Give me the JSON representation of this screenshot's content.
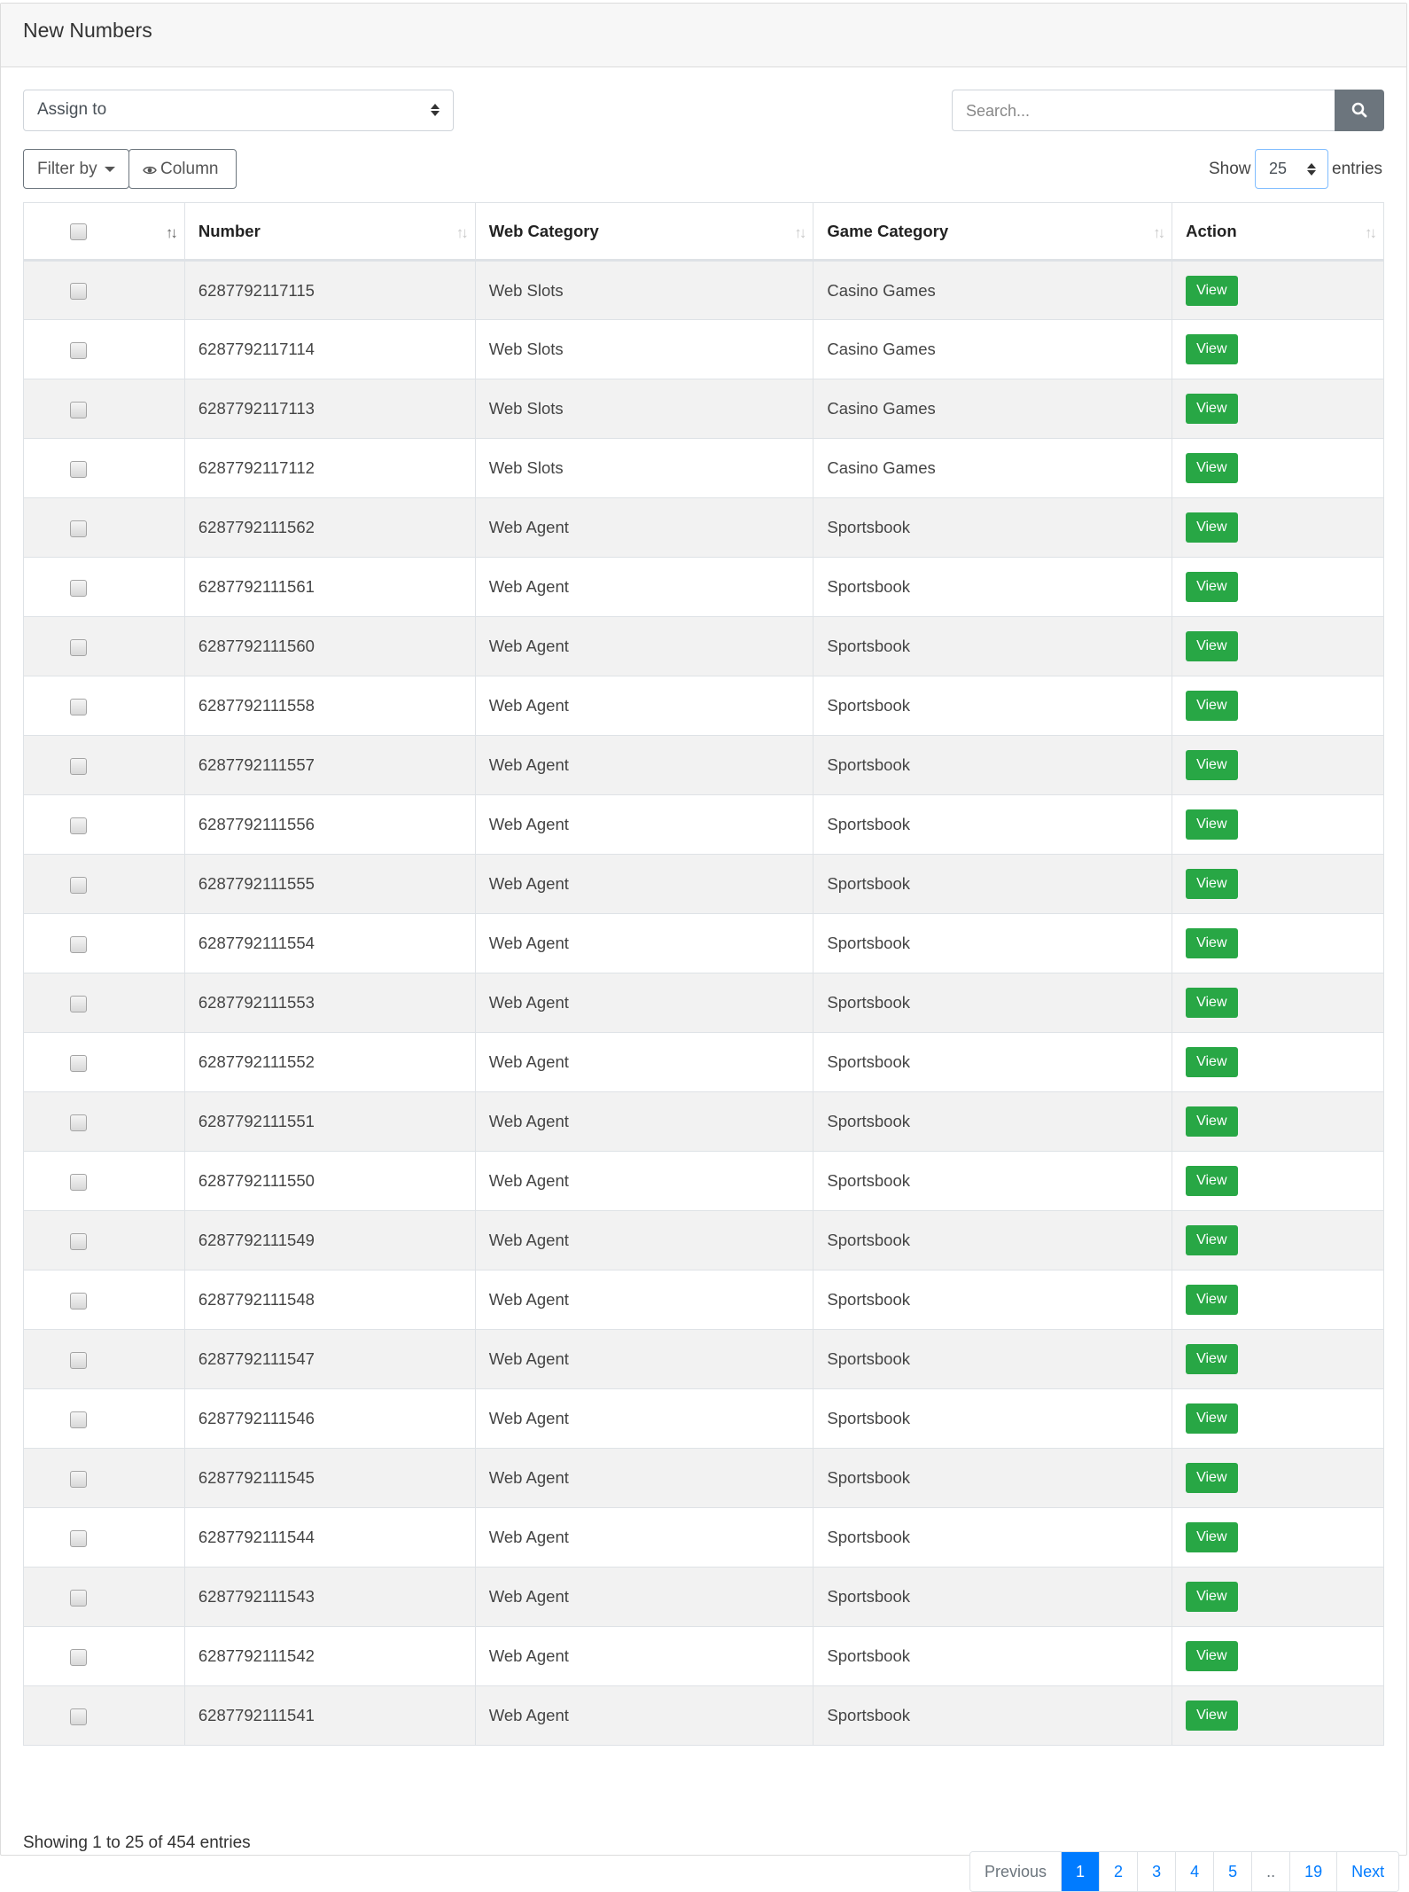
{
  "header": {
    "title": "New Numbers"
  },
  "toolbar": {
    "assign_placeholder": "Assign to",
    "search_placeholder": "Search...",
    "filter_label": "Filter by",
    "column_label": "Column",
    "show_label": "Show",
    "page_size": "25",
    "entries_label": "entries"
  },
  "table": {
    "headers": [
      "",
      "Number",
      "Web Category",
      "Game Category",
      "Action"
    ],
    "rows": [
      {
        "number": "6287792117115",
        "web": "Web Slots",
        "game": "Casino Games",
        "action": "View"
      },
      {
        "number": "6287792117114",
        "web": "Web Slots",
        "game": "Casino Games",
        "action": "View"
      },
      {
        "number": "6287792117113",
        "web": "Web Slots",
        "game": "Casino Games",
        "action": "View"
      },
      {
        "number": "6287792117112",
        "web": "Web Slots",
        "game": "Casino Games",
        "action": "View"
      },
      {
        "number": "6287792111562",
        "web": "Web Agent",
        "game": "Sportsbook",
        "action": "View"
      },
      {
        "number": "6287792111561",
        "web": "Web Agent",
        "game": "Sportsbook",
        "action": "View"
      },
      {
        "number": "6287792111560",
        "web": "Web Agent",
        "game": "Sportsbook",
        "action": "View"
      },
      {
        "number": "6287792111558",
        "web": "Web Agent",
        "game": "Sportsbook",
        "action": "View"
      },
      {
        "number": "6287792111557",
        "web": "Web Agent",
        "game": "Sportsbook",
        "action": "View"
      },
      {
        "number": "6287792111556",
        "web": "Web Agent",
        "game": "Sportsbook",
        "action": "View"
      },
      {
        "number": "6287792111555",
        "web": "Web Agent",
        "game": "Sportsbook",
        "action": "View"
      },
      {
        "number": "6287792111554",
        "web": "Web Agent",
        "game": "Sportsbook",
        "action": "View"
      },
      {
        "number": "6287792111553",
        "web": "Web Agent",
        "game": "Sportsbook",
        "action": "View"
      },
      {
        "number": "6287792111552",
        "web": "Web Agent",
        "game": "Sportsbook",
        "action": "View"
      },
      {
        "number": "6287792111551",
        "web": "Web Agent",
        "game": "Sportsbook",
        "action": "View"
      },
      {
        "number": "6287792111550",
        "web": "Web Agent",
        "game": "Sportsbook",
        "action": "View"
      },
      {
        "number": "6287792111549",
        "web": "Web Agent",
        "game": "Sportsbook",
        "action": "View"
      },
      {
        "number": "6287792111548",
        "web": "Web Agent",
        "game": "Sportsbook",
        "action": "View"
      },
      {
        "number": "6287792111547",
        "web": "Web Agent",
        "game": "Sportsbook",
        "action": "View"
      },
      {
        "number": "6287792111546",
        "web": "Web Agent",
        "game": "Sportsbook",
        "action": "View"
      },
      {
        "number": "6287792111545",
        "web": "Web Agent",
        "game": "Sportsbook",
        "action": "View"
      },
      {
        "number": "6287792111544",
        "web": "Web Agent",
        "game": "Sportsbook",
        "action": "View"
      },
      {
        "number": "6287792111543",
        "web": "Web Agent",
        "game": "Sportsbook",
        "action": "View"
      },
      {
        "number": "6287792111542",
        "web": "Web Agent",
        "game": "Sportsbook",
        "action": "View"
      },
      {
        "number": "6287792111541",
        "web": "Web Agent",
        "game": "Sportsbook",
        "action": "View"
      }
    ]
  },
  "footer": {
    "info": "Showing 1 to 25 of 454 entries"
  },
  "pagination": {
    "previous": "Previous",
    "pages": [
      "1",
      "2",
      "3",
      "4",
      "5",
      "..",
      "19"
    ],
    "current": "1",
    "next": "Next"
  },
  "icons": {
    "search": "search-icon",
    "eye": "eye-icon",
    "sort": "sort-icon",
    "dropdown": "caret-down-icon"
  },
  "colors": {
    "view_button": "#28a745",
    "search_button": "#6c757d",
    "active_page": "#007bff"
  }
}
